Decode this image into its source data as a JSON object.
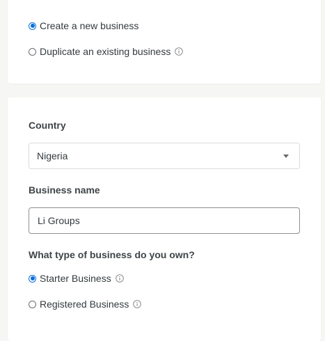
{
  "business_mode": {
    "options": [
      {
        "label": "Create a new business",
        "checked": true,
        "info": false
      },
      {
        "label": "Duplicate an existing business",
        "checked": false,
        "info": true
      }
    ]
  },
  "country": {
    "label": "Country",
    "value": "Nigeria"
  },
  "business_name": {
    "label": "Business name",
    "value": "Li Groups"
  },
  "business_type": {
    "question": "What type of business do you own?",
    "options": [
      {
        "label": "Starter Business",
        "checked": true,
        "info": true
      },
      {
        "label": "Registered Business",
        "checked": false,
        "info": true
      }
    ]
  },
  "colors": {
    "accent": "#0a6fd8",
    "background": "#f6f6f4",
    "card": "#ffffff",
    "text": "#333a3d"
  }
}
